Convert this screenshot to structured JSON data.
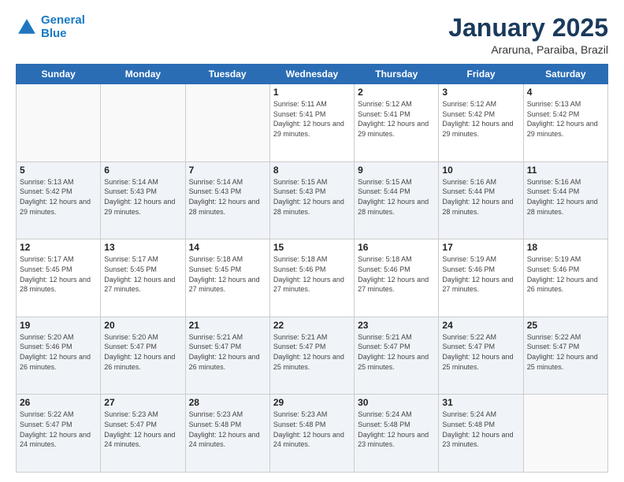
{
  "header": {
    "logo_line1": "General",
    "logo_line2": "Blue",
    "title": "January 2025",
    "subtitle": "Araruna, Paraiba, Brazil"
  },
  "days_of_week": [
    "Sunday",
    "Monday",
    "Tuesday",
    "Wednesday",
    "Thursday",
    "Friday",
    "Saturday"
  ],
  "weeks": [
    [
      {
        "day": "",
        "sunrise": "",
        "sunset": "",
        "daylight": ""
      },
      {
        "day": "",
        "sunrise": "",
        "sunset": "",
        "daylight": ""
      },
      {
        "day": "",
        "sunrise": "",
        "sunset": "",
        "daylight": ""
      },
      {
        "day": "1",
        "sunrise": "Sunrise: 5:11 AM",
        "sunset": "Sunset: 5:41 PM",
        "daylight": "Daylight: 12 hours and 29 minutes."
      },
      {
        "day": "2",
        "sunrise": "Sunrise: 5:12 AM",
        "sunset": "Sunset: 5:41 PM",
        "daylight": "Daylight: 12 hours and 29 minutes."
      },
      {
        "day": "3",
        "sunrise": "Sunrise: 5:12 AM",
        "sunset": "Sunset: 5:42 PM",
        "daylight": "Daylight: 12 hours and 29 minutes."
      },
      {
        "day": "4",
        "sunrise": "Sunrise: 5:13 AM",
        "sunset": "Sunset: 5:42 PM",
        "daylight": "Daylight: 12 hours and 29 minutes."
      }
    ],
    [
      {
        "day": "5",
        "sunrise": "Sunrise: 5:13 AM",
        "sunset": "Sunset: 5:42 PM",
        "daylight": "Daylight: 12 hours and 29 minutes."
      },
      {
        "day": "6",
        "sunrise": "Sunrise: 5:14 AM",
        "sunset": "Sunset: 5:43 PM",
        "daylight": "Daylight: 12 hours and 29 minutes."
      },
      {
        "day": "7",
        "sunrise": "Sunrise: 5:14 AM",
        "sunset": "Sunset: 5:43 PM",
        "daylight": "Daylight: 12 hours and 28 minutes."
      },
      {
        "day": "8",
        "sunrise": "Sunrise: 5:15 AM",
        "sunset": "Sunset: 5:43 PM",
        "daylight": "Daylight: 12 hours and 28 minutes."
      },
      {
        "day": "9",
        "sunrise": "Sunrise: 5:15 AM",
        "sunset": "Sunset: 5:44 PM",
        "daylight": "Daylight: 12 hours and 28 minutes."
      },
      {
        "day": "10",
        "sunrise": "Sunrise: 5:16 AM",
        "sunset": "Sunset: 5:44 PM",
        "daylight": "Daylight: 12 hours and 28 minutes."
      },
      {
        "day": "11",
        "sunrise": "Sunrise: 5:16 AM",
        "sunset": "Sunset: 5:44 PM",
        "daylight": "Daylight: 12 hours and 28 minutes."
      }
    ],
    [
      {
        "day": "12",
        "sunrise": "Sunrise: 5:17 AM",
        "sunset": "Sunset: 5:45 PM",
        "daylight": "Daylight: 12 hours and 28 minutes."
      },
      {
        "day": "13",
        "sunrise": "Sunrise: 5:17 AM",
        "sunset": "Sunset: 5:45 PM",
        "daylight": "Daylight: 12 hours and 27 minutes."
      },
      {
        "day": "14",
        "sunrise": "Sunrise: 5:18 AM",
        "sunset": "Sunset: 5:45 PM",
        "daylight": "Daylight: 12 hours and 27 minutes."
      },
      {
        "day": "15",
        "sunrise": "Sunrise: 5:18 AM",
        "sunset": "Sunset: 5:46 PM",
        "daylight": "Daylight: 12 hours and 27 minutes."
      },
      {
        "day": "16",
        "sunrise": "Sunrise: 5:18 AM",
        "sunset": "Sunset: 5:46 PM",
        "daylight": "Daylight: 12 hours and 27 minutes."
      },
      {
        "day": "17",
        "sunrise": "Sunrise: 5:19 AM",
        "sunset": "Sunset: 5:46 PM",
        "daylight": "Daylight: 12 hours and 27 minutes."
      },
      {
        "day": "18",
        "sunrise": "Sunrise: 5:19 AM",
        "sunset": "Sunset: 5:46 PM",
        "daylight": "Daylight: 12 hours and 26 minutes."
      }
    ],
    [
      {
        "day": "19",
        "sunrise": "Sunrise: 5:20 AM",
        "sunset": "Sunset: 5:46 PM",
        "daylight": "Daylight: 12 hours and 26 minutes."
      },
      {
        "day": "20",
        "sunrise": "Sunrise: 5:20 AM",
        "sunset": "Sunset: 5:47 PM",
        "daylight": "Daylight: 12 hours and 26 minutes."
      },
      {
        "day": "21",
        "sunrise": "Sunrise: 5:21 AM",
        "sunset": "Sunset: 5:47 PM",
        "daylight": "Daylight: 12 hours and 26 minutes."
      },
      {
        "day": "22",
        "sunrise": "Sunrise: 5:21 AM",
        "sunset": "Sunset: 5:47 PM",
        "daylight": "Daylight: 12 hours and 25 minutes."
      },
      {
        "day": "23",
        "sunrise": "Sunrise: 5:21 AM",
        "sunset": "Sunset: 5:47 PM",
        "daylight": "Daylight: 12 hours and 25 minutes."
      },
      {
        "day": "24",
        "sunrise": "Sunrise: 5:22 AM",
        "sunset": "Sunset: 5:47 PM",
        "daylight": "Daylight: 12 hours and 25 minutes."
      },
      {
        "day": "25",
        "sunrise": "Sunrise: 5:22 AM",
        "sunset": "Sunset: 5:47 PM",
        "daylight": "Daylight: 12 hours and 25 minutes."
      }
    ],
    [
      {
        "day": "26",
        "sunrise": "Sunrise: 5:22 AM",
        "sunset": "Sunset: 5:47 PM",
        "daylight": "Daylight: 12 hours and 24 minutes."
      },
      {
        "day": "27",
        "sunrise": "Sunrise: 5:23 AM",
        "sunset": "Sunset: 5:47 PM",
        "daylight": "Daylight: 12 hours and 24 minutes."
      },
      {
        "day": "28",
        "sunrise": "Sunrise: 5:23 AM",
        "sunset": "Sunset: 5:48 PM",
        "daylight": "Daylight: 12 hours and 24 minutes."
      },
      {
        "day": "29",
        "sunrise": "Sunrise: 5:23 AM",
        "sunset": "Sunset: 5:48 PM",
        "daylight": "Daylight: 12 hours and 24 minutes."
      },
      {
        "day": "30",
        "sunrise": "Sunrise: 5:24 AM",
        "sunset": "Sunset: 5:48 PM",
        "daylight": "Daylight: 12 hours and 23 minutes."
      },
      {
        "day": "31",
        "sunrise": "Sunrise: 5:24 AM",
        "sunset": "Sunset: 5:48 PM",
        "daylight": "Daylight: 12 hours and 23 minutes."
      },
      {
        "day": "",
        "sunrise": "",
        "sunset": "",
        "daylight": ""
      }
    ]
  ]
}
